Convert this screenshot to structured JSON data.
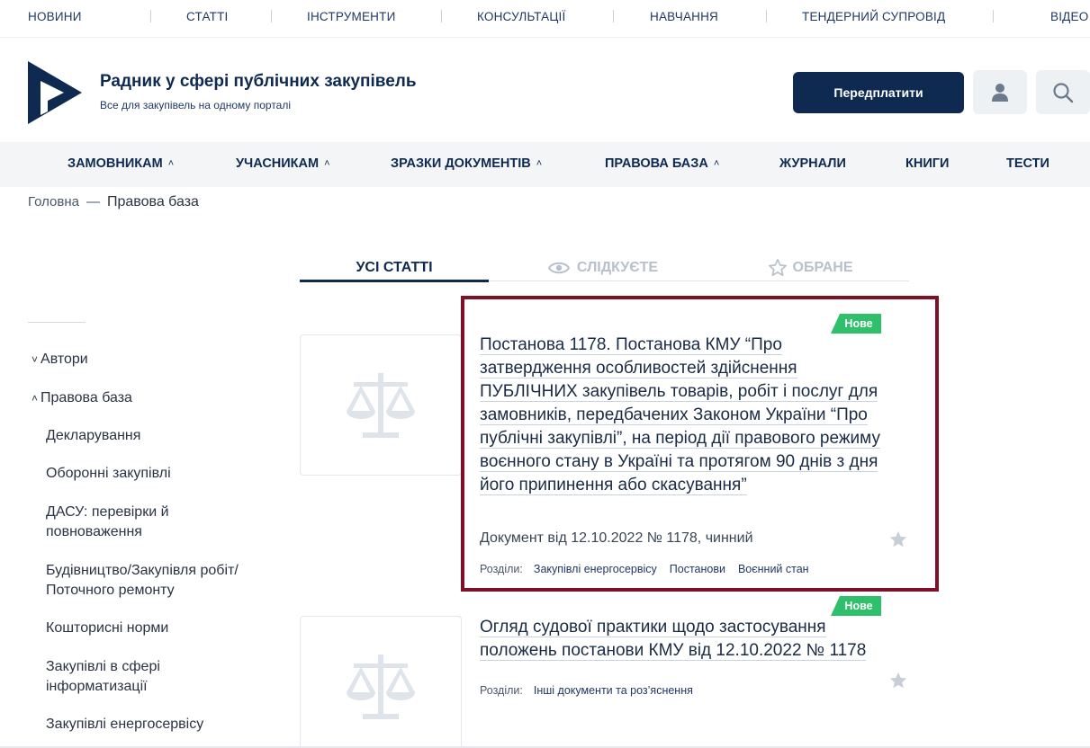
{
  "topnav": {
    "items": [
      "НОВИНИ",
      "СТАТТІ",
      "ІНСТРУМЕНТИ",
      "КОНСУЛЬТАЦІЇ",
      "НАВЧАННЯ",
      "ТЕНДЕРНИЙ СУПРОВІД",
      "ВІДЕО"
    ]
  },
  "header": {
    "title": "Радник у сфері публічних закупівель",
    "subtitle": "Все для закупівель на одному порталі",
    "subscribe_label": "Передплатити",
    "user_icon": "user-icon",
    "search_icon": "search-icon"
  },
  "mainnav": {
    "items": [
      "ЗАМОВНИКАМ",
      "УЧАСНИКАМ",
      "ЗРАЗКИ ДОКУМЕНТІВ",
      "ПРАВОВА БАЗА",
      "ЖУРНАЛИ",
      "КНИГИ",
      "ТЕСТИ"
    ],
    "chevron": "˄"
  },
  "breadcrumb": {
    "home": "Головна",
    "separator": "—",
    "current": "Правова база"
  },
  "tabs": {
    "all": "УСІ СТАТТІ",
    "watching": "СЛІДКУЄТЕ",
    "favorites": "ОБРАНЕ"
  },
  "sidebar": {
    "toggle_collapsed": "˅",
    "toggle_expanded": "˄",
    "groups": [
      "Автори",
      "Правова база"
    ],
    "items": [
      "Декларування",
      "Оборонні закупівлі",
      "ДАСУ: перевірки й повноваження",
      "Будівництво/Закупівля робіт/ Поточного ремонту",
      "Кошторисні норми",
      "Закупівлі в сфері інформатизації",
      "Закупівлі енергосервісу"
    ]
  },
  "articles": [
    {
      "badge": "Нове",
      "title": "Постанова 1178. Постанова КМУ “Про затвердження особливостей здійснення ПУБЛІЧНИХ закупівель товарів, робіт і послуг для замовників, передбачених Законом України “Про публічні закупівлі”, на період дії правового режиму воєнного стану в Україні та протягом 90 днів з дня його припинення або скасування”",
      "meta": "Документ від 12.10.2022 № 1178, чинний",
      "sections_label": "Розділи:",
      "sections": [
        "Закупівлі енергосервісу",
        "Постанови",
        "Воєнний стан"
      ]
    },
    {
      "badge": "Нове",
      "title": "Огляд судової практики щодо застосування положень постанови КМУ від 12.10.2022 № 1178",
      "sections_label": "Розділи:",
      "sections": [
        "Інші документи та роз’яснення"
      ]
    }
  ],
  "colors": {
    "brand_navy": "#0f2a50",
    "badge_green": "#2ec06a",
    "highlight": "#7c1128"
  }
}
